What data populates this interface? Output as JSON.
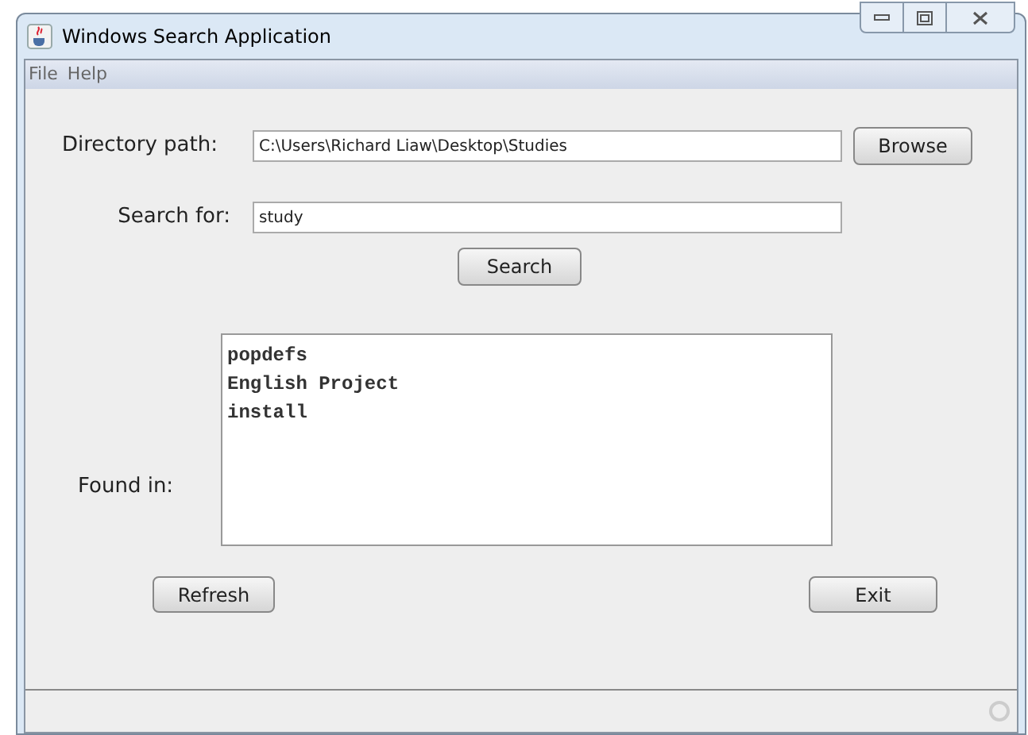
{
  "window": {
    "title": "Windows Search Application"
  },
  "menu": [
    "File",
    "Help"
  ],
  "directory": {
    "label": "Directory path:",
    "value": "C:\\Users\\Richard Liaw\\Desktop\\Studies",
    "button": "Browse"
  },
  "search": {
    "label": "Search for:",
    "value": "study",
    "button": "Search"
  },
  "results": {
    "label": "Found in:",
    "items": [
      "popdefs",
      "English Project",
      "install"
    ]
  },
  "buttons": [
    "Refresh",
    "Exit"
  ]
}
